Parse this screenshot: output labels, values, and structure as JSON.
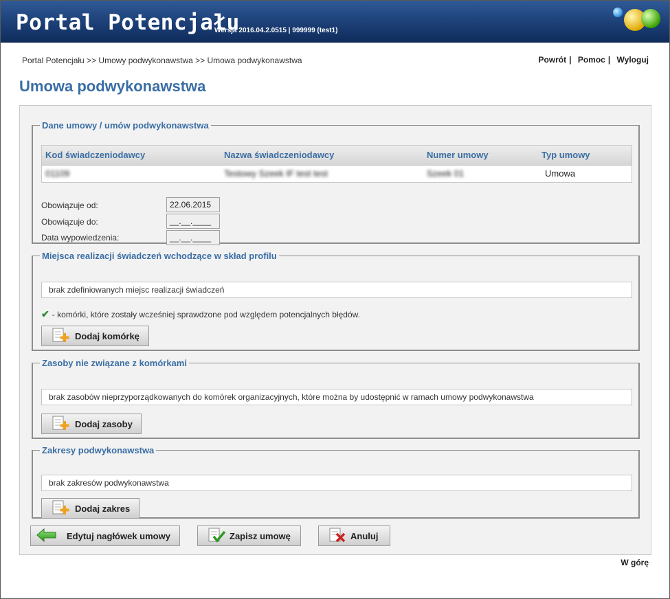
{
  "header": {
    "title": "Portal Potencjału",
    "version": "Wersja 2016.04.2.0515 | 999999 (test1)"
  },
  "breadcrumb": "Portal Potencjału >> Umowy podwykonawstwa >> Umowa podwykonawstwa",
  "nav": {
    "back": "Powrót",
    "help": "Pomoc",
    "logout": "Wyloguj"
  },
  "page_title": "Umowa podwykonawstwa",
  "contract": {
    "legend": "Dane umowy / umów podwykonawstwa",
    "columns": [
      "Kod świadczeniodawcy",
      "Nazwa świadczeniodawcy",
      "Numer umowy",
      "Typ umowy"
    ],
    "row": [
      "01109",
      "Testowy Szeek IF test test",
      "Szeek 01",
      "Umowa"
    ],
    "fields": {
      "valid_from_label": "Obowiązuje od:",
      "valid_from_value": "22.06.2015",
      "valid_to_label": "Obowiązuje do:",
      "valid_to_value": "__.__.____",
      "termination_label": "Data wypowiedzenia:",
      "termination_value": "__.__.____"
    }
  },
  "locations": {
    "legend": "Miejsca realizacji świadczeń wchodzące w skład profilu",
    "empty_text": "brak zdefiniowanych miejsc realizacji świadczeń",
    "note": "- komórki, które zostały wcześniej sprawdzone pod względem potencjalnych błędów.",
    "add_button": "Dodaj komórkę"
  },
  "resources": {
    "legend": "Zasoby nie związane z komórkami",
    "empty_text": "brak zasobów nieprzyporządkowanych do komórek organizacyjnych, które można by udostępnić w ramach umowy podwykonawstwa",
    "add_button": "Dodaj zasoby"
  },
  "scopes": {
    "legend": "Zakresy podwykonawstwa",
    "empty_text": "brak zakresów podwykonawstwa",
    "add_button": "Dodaj zakres"
  },
  "actions": {
    "edit_header": "Edytuj nagłówek umowy",
    "save": "Zapisz umowę",
    "cancel": "Anuluj"
  },
  "footer": {
    "top_link": "W górę"
  },
  "colors": {
    "accent": "#3a6ea5",
    "header_bg": "#1c3f76",
    "check": "#2e8b2e",
    "cancel_x": "#cc2222",
    "add_plus": "#f0a020"
  }
}
